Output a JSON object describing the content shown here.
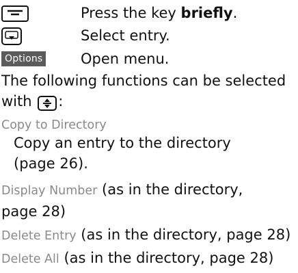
{
  "steps": [
    {
      "key_icon": "end-call-key-icon",
      "text_before": "Press the key ",
      "text_bold": "briefly",
      "text_after": "."
    },
    {
      "key_icon": "control-key-down-icon",
      "text": "Select entry."
    },
    {
      "key_label": "Options",
      "text": "Open menu."
    }
  ],
  "intro": {
    "line1": "The following functions can be selected",
    "line2_before": "with ",
    "line2_after": ":",
    "icon": "control-key-up-down-icon"
  },
  "options": [
    {
      "name": "Copy to Directory",
      "desc_line1": "Copy an entry to the directory",
      "desc_line2": "(page 26)."
    },
    {
      "name": "Display Number",
      "suffix_line1": " (as in the directory,",
      "suffix_line2": "page 28)"
    },
    {
      "name": "Delete Entry",
      "suffix": " (as in the directory, page 28)"
    },
    {
      "name": "Delete All",
      "suffix": " (as in the directory, page 28)"
    }
  ]
}
